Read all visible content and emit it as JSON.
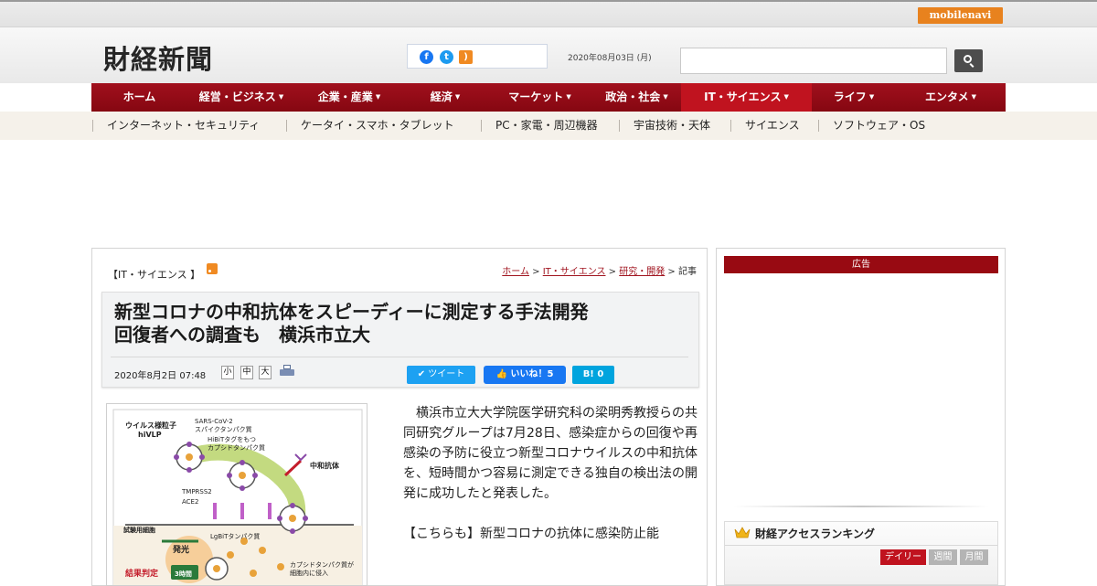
{
  "topbar": {
    "mobilenavi_label": "mobilenavi"
  },
  "header": {
    "logo": "財経新聞",
    "date": "2020年08月03日 (月)",
    "social_icons": [
      "facebook-icon",
      "twitter-icon",
      "rss-icon"
    ],
    "search_placeholder": ""
  },
  "nav": {
    "items": [
      {
        "label": "ホーム",
        "caret": ""
      },
      {
        "label": "経営・ビジネス",
        "caret": "▼"
      },
      {
        "label": "企業・産業",
        "caret": "▼"
      },
      {
        "label": "経済",
        "caret": "▼"
      },
      {
        "label": "マーケット",
        "caret": "▼"
      },
      {
        "label": "政治・社会",
        "caret": "▼"
      },
      {
        "label": "IT・サイエンス",
        "caret": "▼"
      },
      {
        "label": "ライフ",
        "caret": "▼"
      },
      {
        "label": "エンタメ",
        "caret": "▼"
      }
    ],
    "active": "IT・サイエンス"
  },
  "subnav": {
    "items": [
      "インターネット・セキュリティ",
      "ケータイ・スマホ・タブレット",
      "PC・家電・周辺機器",
      "宇宙技術・天体",
      "サイエンス",
      "ソフトウェア・OS"
    ]
  },
  "article": {
    "category": "【IT・サイエンス 】",
    "breadcrumb": {
      "home": "ホーム",
      "cat": "IT・サイエンス",
      "sub": "研究・開発",
      "sep": " > ",
      "current": "記事"
    },
    "title_line1": "新型コロナの中和抗体をスピーディーに測定する手法開発",
    "title_line2": "回復者への調査も　横浜市立大",
    "date": "2020年8月2日 07:48",
    "font_sizes": [
      "小",
      "中",
      "大"
    ],
    "share": {
      "tweet": "ツイート",
      "like": "いいね！5",
      "hatena": "B!  0"
    },
    "body_p1": "横浜市立大大学院医学研究科の梁明秀教授らの共同研究グループは7月28日、感染症からの回復や再感染の予防に役立つ新型コロナウイルスの中和抗体を、短時間かつ容易に測定できる独自の検出法の開発に成功したと発表した。",
    "body_p2": "【こちらも】新型コロナの抗体に感染防止能"
  },
  "figure": {
    "labels": {
      "particle": "ウイルス様粒子",
      "hivlp": "hiVLP",
      "sars": "SARS-CoV-2",
      "spike": "スパイクタンパク質",
      "hibit1": "HiBiTタグをもつ",
      "hibit2": "カプシドタンパク質",
      "antibody": "中和抗体",
      "tmprss2": "TMPRSS2",
      "ace2": "ACE2",
      "cell": "試験用細胞",
      "lgbit": "LgBiTタンパク質",
      "light": "発光",
      "result": "結果判定",
      "time": "3時間",
      "capsid1": "カプシドタンパク質が",
      "capsid2": "細胞内に侵入"
    }
  },
  "sidebar": {
    "ad_label": "広告",
    "ranking_title": "財経アクセスランキング",
    "ranking_tabs": [
      "デイリー",
      "週間",
      "月間"
    ],
    "active_tab": "デイリー"
  },
  "colors": {
    "nav_red": "#a1101d",
    "nav_active": "#c0131f",
    "accent_orange": "#e8821e",
    "link_red": "#a11520"
  }
}
